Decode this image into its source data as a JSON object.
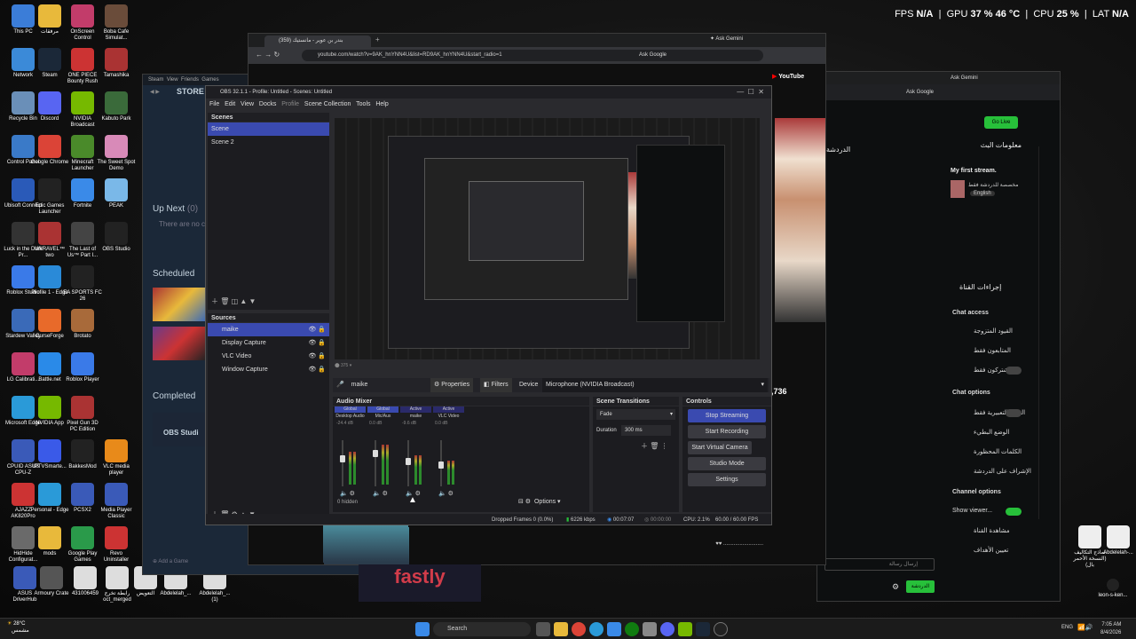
{
  "overlay": {
    "fps_label": "FPS",
    "fps": "N/A",
    "gpu_label": "GPU",
    "gpu": "37 %  46 °C",
    "cpu_label": "CPU",
    "cpu": "25 %",
    "lat_label": "LAT",
    "lat": "N/A"
  },
  "desktop_icons": [
    {
      "label": "This PC",
      "color": "#3b7dd8"
    },
    {
      "label": "مرفقات",
      "color": "#e8b93b"
    },
    {
      "label": "OnScreen Control",
      "color": "#c23c6a"
    },
    {
      "label": "Boba Cafe Simulat...",
      "color": "#6a4c3a"
    },
    {
      "label": "Network",
      "color": "#3b8ad8"
    },
    {
      "label": "Steam",
      "color": "#1b2838"
    },
    {
      "label": "ONE PIECE Bounty Rush",
      "color": "#c33"
    },
    {
      "label": "Tamashika",
      "color": "#a33"
    },
    {
      "label": "Recycle Bin",
      "color": "#6a8fb8"
    },
    {
      "label": "Discord",
      "color": "#5865f2"
    },
    {
      "label": "NVIDIA Broadcast",
      "color": "#76b900"
    },
    {
      "label": "Kabuto Park",
      "color": "#3a6a3a"
    },
    {
      "label": "Control Panel",
      "color": "#3a7ac8"
    },
    {
      "label": "Google Chrome",
      "color": "#db4437"
    },
    {
      "label": "Minecraft Launcher",
      "color": "#4a8a2a"
    },
    {
      "label": "The Sweet Spot Demo",
      "color": "#d88ab8"
    },
    {
      "label": "Ubisoft Connect",
      "color": "#2a5ab8"
    },
    {
      "label": "Epic Games Launcher",
      "color": "#222"
    },
    {
      "label": "Fortnite",
      "color": "#3a8ae8"
    },
    {
      "label": "PEAK",
      "color": "#7ab8e8"
    },
    {
      "label": "Luck in the Dark Pr...",
      "color": "#333"
    },
    {
      "label": "UNRAVEL™ two",
      "color": "#a33"
    },
    {
      "label": "The Last of Us™ Part I...",
      "color": "#444"
    },
    {
      "label": "OBS Studio",
      "color": "#222"
    },
    {
      "label": "Roblox Studio",
      "color": "#3a7ae8"
    },
    {
      "label": "Profile 1 - Edge",
      "color": "#2a8ad8"
    },
    {
      "label": "EA SPORTS FC 26",
      "color": "#222"
    },
    {
      "label": "Stardew Valley",
      "color": "#3a6ab8"
    },
    {
      "label": "CurseForge",
      "color": "#e86a2a"
    },
    {
      "label": "Brotato",
      "color": "#a86a3a"
    },
    {
      "label": "LG Calibrati...",
      "color": "#c23c6a"
    },
    {
      "label": "Battle.net",
      "color": "#2a8ae8"
    },
    {
      "label": "Roblox Player",
      "color": "#3a7ae8"
    },
    {
      "label": "Microsoft Edge",
      "color": "#2a9ad8"
    },
    {
      "label": "NVIDIA App",
      "color": "#76b900"
    },
    {
      "label": "Pixel Gun 3D PC Edition",
      "color": "#a33"
    },
    {
      "label": "CPUID ASUS CPU-Z",
      "color": "#3a5ab8"
    },
    {
      "label": "IPTVSmarte...",
      "color": "#3a5ae8"
    },
    {
      "label": "BakkesMod",
      "color": "#222"
    },
    {
      "label": "VLC media player",
      "color": "#e88a1a"
    },
    {
      "label": "AJAZZ AK820Pro",
      "color": "#c33"
    },
    {
      "label": "Personal - Edge",
      "color": "#2a9ad8"
    },
    {
      "label": "PCSX2",
      "color": "#3a5ab8"
    },
    {
      "label": "Media Player Classic",
      "color": "#3a5ab8"
    },
    {
      "label": "HidHide Configurat...",
      "color": "#6a6a6a"
    },
    {
      "label": "mods",
      "color": "#e8b93b"
    },
    {
      "label": "Google Play Games",
      "color": "#2a9a4a"
    },
    {
      "label": "Revo Uninstaller",
      "color": "#c33"
    },
    {
      "label": "ASUS DriverHub",
      "color": "#3a5ab8"
    },
    {
      "label": "Armoury Crate",
      "color": "#555"
    },
    {
      "label": "431006459",
      "color": "#ddd"
    },
    {
      "label": "رابطة تخرج oct_merged",
      "color": "#ddd"
    },
    {
      "label": "التعويض",
      "color": "#ddd"
    },
    {
      "label": "Abdelelah_...",
      "color": "#ddd"
    },
    {
      "label": "Abdelelah_... (1)",
      "color": "#ddd"
    }
  ],
  "right_icons": [
    {
      "label": "نماذج التكاليف (النسخة الأحمر بال)"
    },
    {
      "label": "Abdelelah-..."
    },
    {
      "label": "leon-s-ken..."
    }
  ],
  "steam": {
    "title": "Steam",
    "menu": [
      "View",
      "Friends",
      "Games",
      "Help"
    ],
    "store": "STORE",
    "up_next": "Up Next",
    "up_next_count": "(0)",
    "no_content": "There are no c",
    "scheduled": "Scheduled",
    "completed": "Completed",
    "obs_card": "OBS Studi",
    "add_game": "Add a Game"
  },
  "browser": {
    "tab_title": "(359) بندر بن عوير - مانستيك",
    "new_tab": "+",
    "url": "youtube.com/watch?v=9AK_hnYNN4U&list=RD9AK_hnYNN4U&start_radio=1",
    "ask_google": "Ask Google",
    "ask_gemini": "Ask Gemini",
    "yt_logo": "YouTube"
  },
  "kick": {
    "ask_gemini": "Ask Gemini",
    "ask_google": "Ask Google",
    "go_live": "Go Live",
    "chat_title": "الدردشة",
    "info_title": "معلومات البث",
    "stream_title": "My first stream.",
    "category": "مخصصة للدردشة فقط",
    "language": "English",
    "channel_actions": "إجراءات القناة",
    "chat_access": "Chat access",
    "followers_only": "القيود المتزوجة",
    "followers_value": "معطل",
    "subscribers": "المتابعون فقط",
    "subscribers_value": "معطل",
    "subs_only": "المشتركون فقط",
    "chat_options": "Chat options",
    "emote_only": "السور التعبيرية فقط",
    "slow_mode": "الوضع البطيء",
    "slow_value": "معطل",
    "banned_words": "الكلمات المحظورة",
    "moderation": "الإشراف على الدردشة",
    "channel_options": "Channel options",
    "show_viewer": "Show viewer...",
    "viewer_list": "مشاهدة القناة",
    "goals": "تعيين الأهداف",
    "send_placeholder": "إرسال رسالة",
    "chat_btn": "الدردشة",
    "count": "2,736"
  },
  "obs": {
    "title": "OBS 32.1.1 - Profile: Untitled - Scenes: Untitled",
    "menu": [
      "File",
      "Edit",
      "View",
      "Docks",
      "Profile",
      "Scene Collection",
      "Tools",
      "Help"
    ],
    "scenes_title": "Scenes",
    "scenes": [
      "Scene",
      "Scene 2"
    ],
    "sources_title": "Sources",
    "sources": [
      "maike",
      "Display Capture",
      "VLC Video",
      "Window Capture"
    ],
    "source_bar_name": "maike",
    "properties": "Properties",
    "filters": "Filters",
    "device_label": "Device",
    "device_value": "Microphone (NVIDIA Broadcast)",
    "mixer_title": "Audio Mixer",
    "channels": [
      {
        "tag": "Global",
        "name": "Desktop Audio",
        "db": "-24.4 dB",
        "level": 0.62,
        "color": "#3a4ab0"
      },
      {
        "tag": "Global",
        "name": "Mic/Aux",
        "db": "0.0 dB",
        "level": 0.75,
        "color": "#3a4ab0"
      },
      {
        "tag": "Active",
        "name": "maike",
        "db": "-9.6 dB",
        "level": 0.55,
        "color": "#2a2a6a"
      },
      {
        "tag": "Active",
        "name": "VLC Video",
        "db": "0.0 dB",
        "level": 0.45,
        "color": "#2a2a6a"
      }
    ],
    "transitions_title": "Scene Transitions",
    "transition": "Fade",
    "duration_label": "Duration",
    "duration": "300 ms",
    "controls_title": "Controls",
    "stop_streaming": "Stop Streaming",
    "start_recording": "Start Recording",
    "start_virtual": "Start Virtual Camera",
    "studio_mode": "Studio Mode",
    "settings": "Settings",
    "hidden": "0 hidden",
    "options": "Options",
    "status_dropped": "Dropped Frames 0 (0.0%)",
    "status_kbps": "6226 kbps",
    "status_stream_time": "00:07:07",
    "status_rec_time": "00:00:00",
    "status_cpu": "CPU: 2.1%",
    "status_fps": "60.00 / 60.00 FPS"
  },
  "tiles": {
    "fastly": "fastly"
  },
  "taskbar": {
    "weather_temp": "28°C",
    "weather_desc": "مشمس",
    "search": "Search",
    "lang": "ENG",
    "time": "7:05 AM",
    "date": "8/4/2026"
  }
}
